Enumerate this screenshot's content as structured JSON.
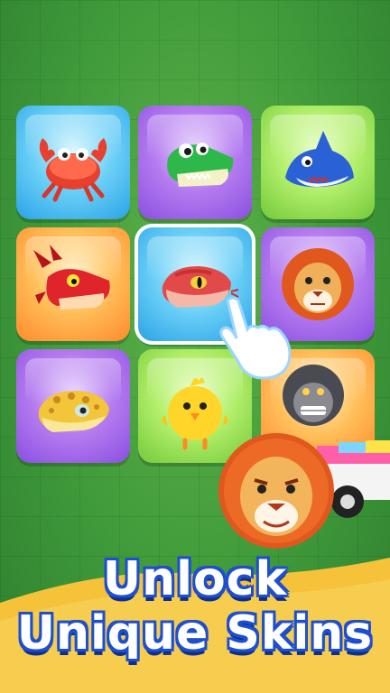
{
  "title": {
    "line1": "Unlock",
    "line2": "Unique Skins"
  },
  "skins": [
    {
      "name": "crab",
      "bg": "blue"
    },
    {
      "name": "crocodile",
      "bg": "purple"
    },
    {
      "name": "shark",
      "bg": "green"
    },
    {
      "name": "dragon",
      "bg": "orange"
    },
    {
      "name": "snake",
      "bg": "blue",
      "selected": true
    },
    {
      "name": "lion",
      "bg": "purple"
    },
    {
      "name": "leopard-gecko",
      "bg": "purple"
    },
    {
      "name": "chick",
      "bg": "green"
    },
    {
      "name": "gorilla",
      "bg": "orange"
    }
  ],
  "colors": {
    "title_fill": "#ffffff",
    "title_outline": "#1d4fcf",
    "banner": "#f6c23a",
    "background": "#3f9a3a"
  }
}
